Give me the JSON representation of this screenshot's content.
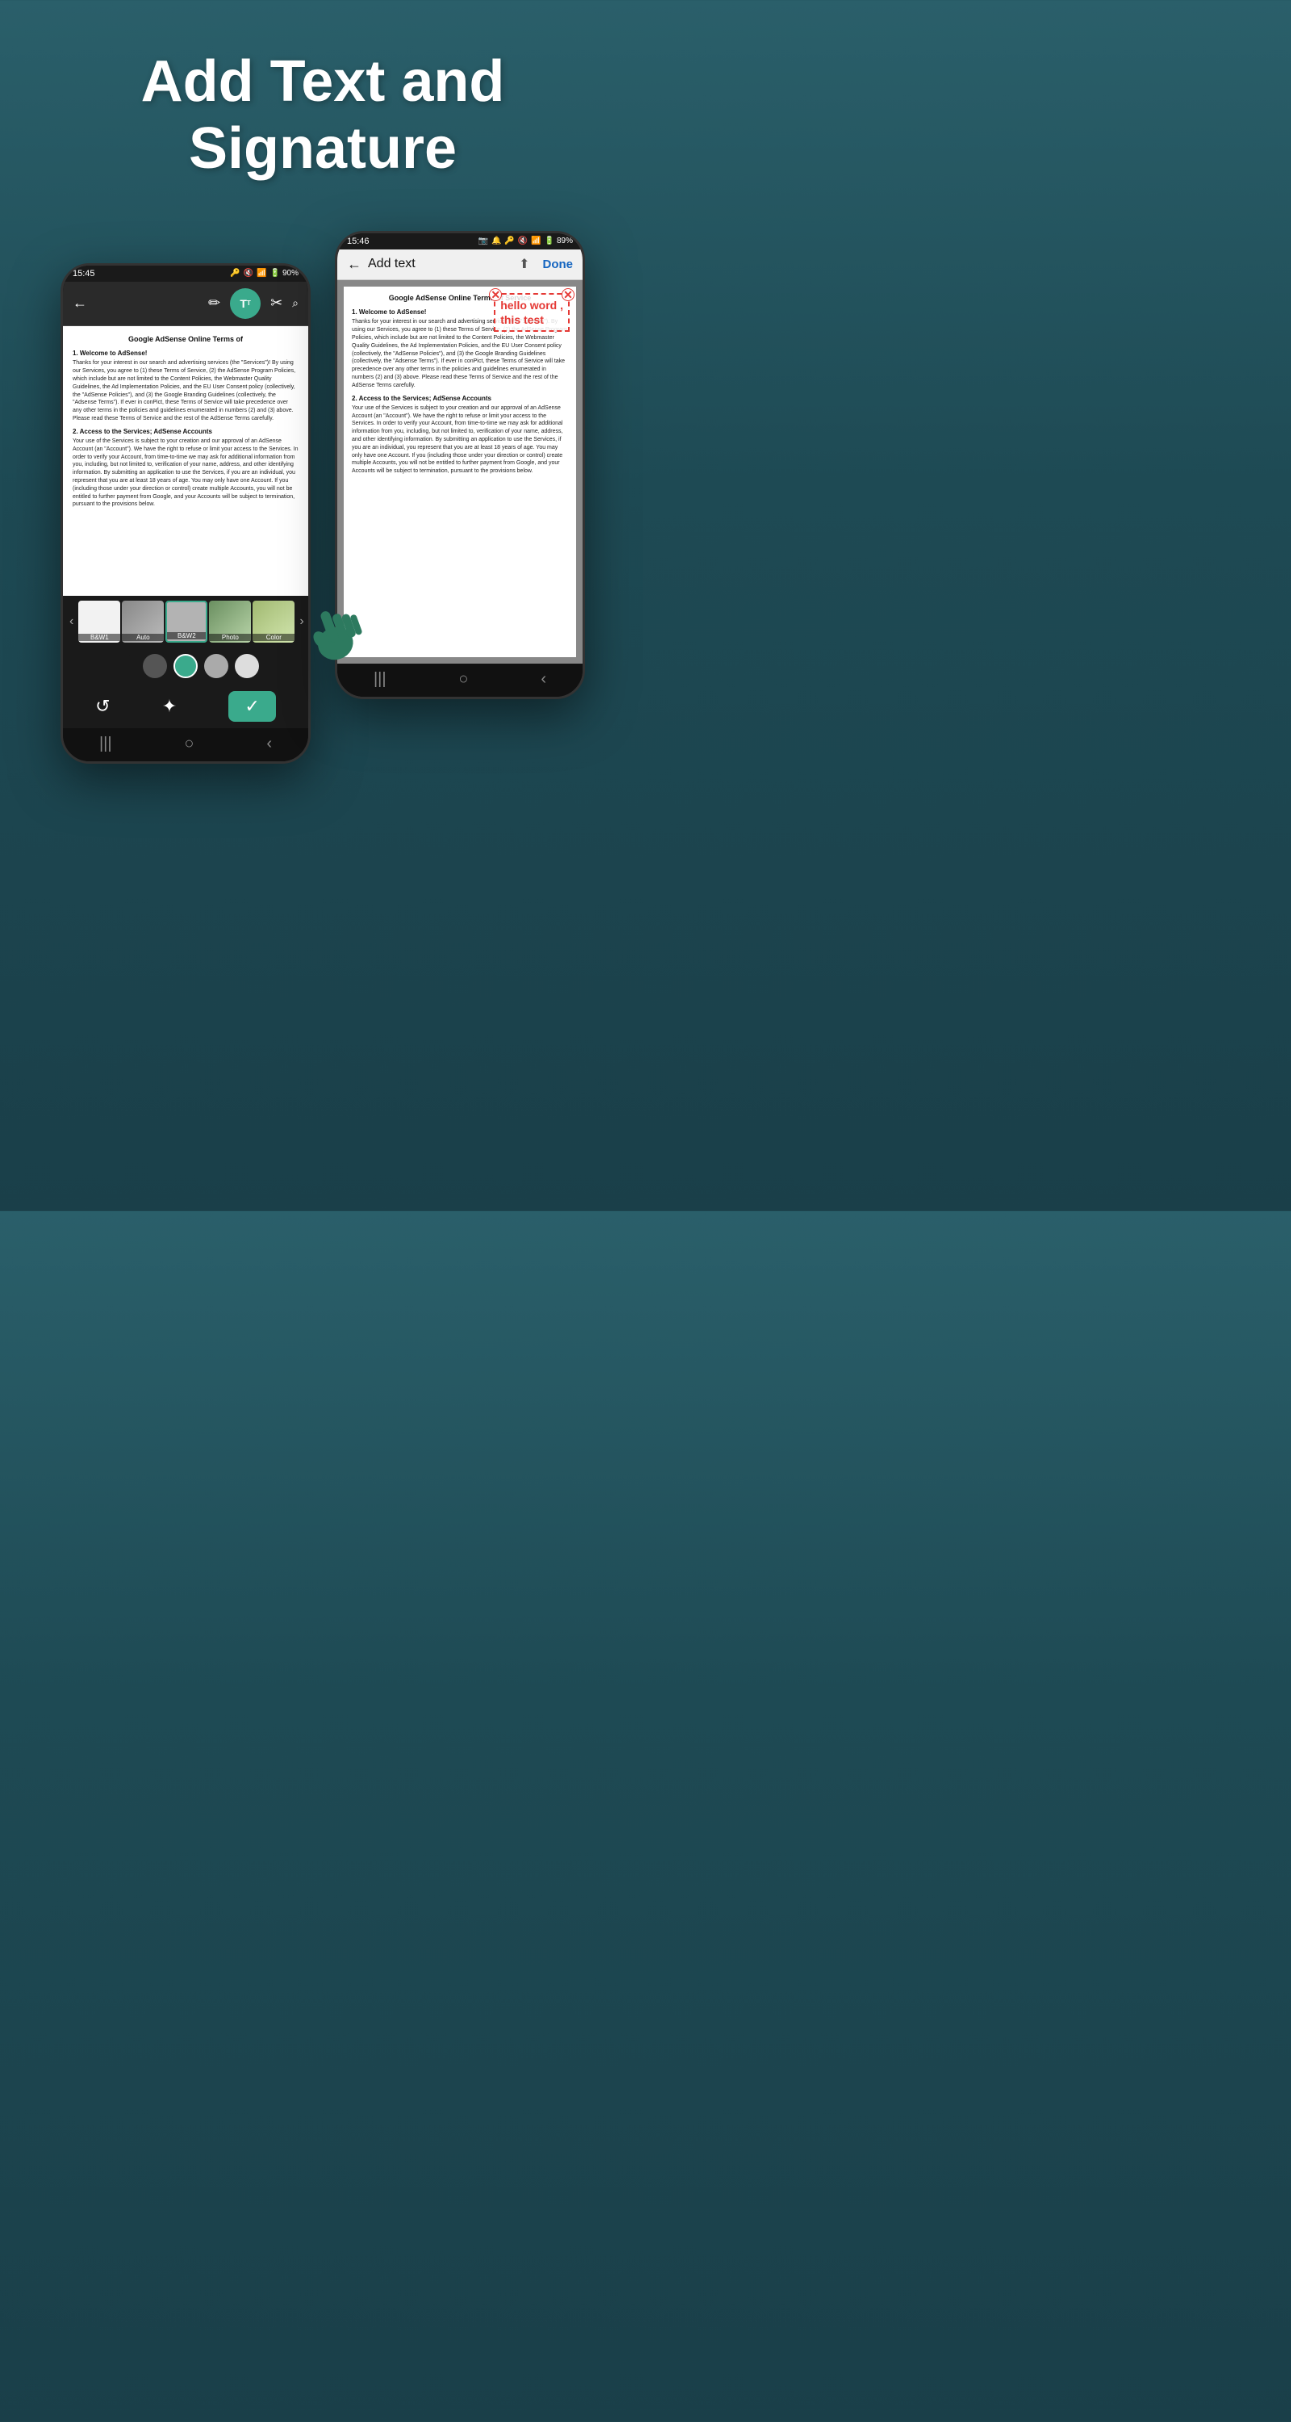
{
  "header": {
    "line1": "Add Text and",
    "line2": "Signature"
  },
  "phone_left": {
    "status": {
      "time": "15:45",
      "icons": "🔑 🔇 📶 🔋 90%"
    },
    "toolbar": {
      "back_icon": "←",
      "edit_icon": "✏",
      "text_icon": "T",
      "crop_icon": "✂",
      "search_icon": "🔍"
    },
    "document": {
      "title": "Google AdSense Online Terms of",
      "section1": "1.   Welcome to AdSense!",
      "body1": "Thanks for your interest in our search and advertising services (the \"Services\")! By using our Services, you agree to (1) these Terms of Service, (2) the AdSense Program Policies, which include but are not limited to the Content Policies, the Webmaster Quality Guidelines, the Ad Implementation Policies, and the EU User Consent policy (collectively, the \"AdSense Policies\"), and (3) the Google Branding Guidelines (collectively, the \"Adsense Terms\"). If ever in conPict, these Terms of Service will take precedence over any other terms in the policies and guidelines enumerated in numbers (2) and (3) above. Please read these Terms of Service and the rest of the AdSense Terms carefully.",
      "section2": "2.  Access to the Services; AdSense Accounts",
      "body2": "Your use of the Services is subject to your creation and our approval of an AdSense Account (an \"Account\"). We have the right to refuse or limit your access to the Services. In order to verify your Account, from time-to-time we may ask for additional information from you, including, but not limited to, verification of your name, address, and other identifying information. By submitting an application to use the Services, if you are an individual, you represent that you are at least 18 years of age. You may only have one Account. If you (including those under your direction or control) create multiple Accounts, you will not be entitled to further payment from Google, and your Accounts will be subject to termination, pursuant to the provisions below."
    },
    "filters": {
      "items": [
        "B&W1",
        "Auto",
        "B&W2",
        "Photo",
        "Color"
      ]
    },
    "colors": [
      "#1a1a1a",
      "#555555",
      "#3aaa8c",
      "#aaaaaa",
      "#dddddd"
    ],
    "action_bar": {
      "reset_icon": "↺",
      "magic_icon": "✦",
      "check_icon": "✓"
    }
  },
  "phone_right": {
    "status": {
      "time": "15:46",
      "icons": "📷 🔔 🔑 🔇 📶 🔋 89%"
    },
    "toolbar": {
      "back_icon": "←",
      "title": "Add text",
      "export_icon": "⬆",
      "done_label": "Done"
    },
    "annotation": {
      "text": "hello word ,\nthis test"
    },
    "document": {
      "title": "Google AdSense Online Terms of Service",
      "section1": "1.   Welcome to AdSense!",
      "body1": "Thanks for your interest in our search and advertising services (the \"Services\"). By using our Services, you agree to (1) these Terms of Service, (2) the AdSense Program Policies, which include but are not limited to the Content Policies, the Webmaster Quality Guidelines, the Ad Implementation Policies, and the EU User Consent policy (collectively, the \"AdSense Policies\"), and (3) the Google Branding Guidelines (collectively, the \"Adsense Terms\"). If ever in conPict, these Terms of Service will take precedence over any other terms in the policies and guidelines enumerated in numbers (2) and (3) above. Please read these Terms of Service and the rest of the AdSense Terms carefully.",
      "section2": "2.  Access to the Services; AdSense Accounts",
      "body2": "Your use of the Services is subject to your creation and our approval of an AdSense Account (an \"Account\"). We have the right to refuse or limit your access to the Services. In order to verify your Account, from time-to-time we may ask for additional information from you, including, but not limited to, verification of your name, address, and other identifying information. By submitting an application to use the Services, if you are an individual, you represent that you are at least 18 years of age. You may only have one Account. If you (including those under your direction or control) create multiple Accounts, you will not be entitled to further payment from Google, and your Accounts will be subject to termination, pursuant to the provisions below."
    }
  }
}
